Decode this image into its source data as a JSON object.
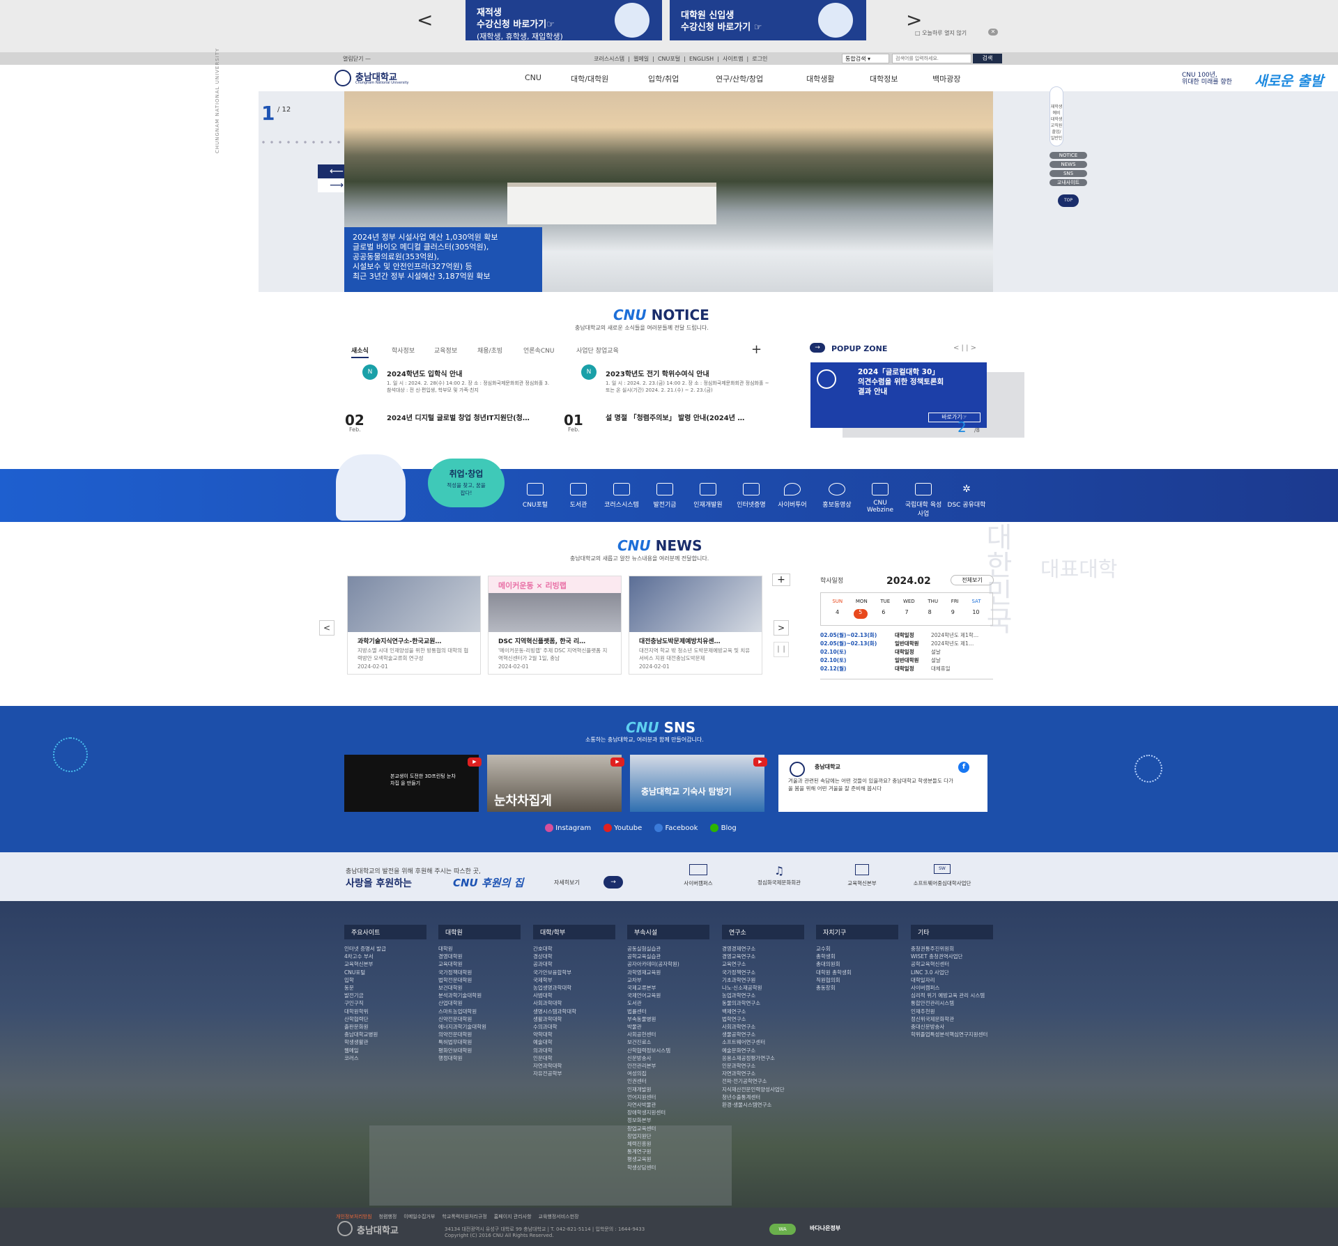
{
  "top_banner": {
    "btn1_line1": "재적생",
    "btn1_line2": "수강신청 바로가기☞",
    "btn1_line3": "(재학생, 휴학생, 재입학생)",
    "btn2_line1": "대학원 신입생",
    "btn2_line2": "수강신청 바로가기 ☞",
    "prev": "<",
    "next": ">",
    "close_today": "□ 오늘하루 열지 않기"
  },
  "util": {
    "quicklinks": "열림닫기 —",
    "menu": "코러스시스템  |  웹메일  |  CNU포털  |  ENGLISH  |  사이트맵  |  로그인",
    "search_scope": "통합검색",
    "search_placeholder": "검색어를 입력하세요.",
    "search_btn": "검색"
  },
  "gnb": {
    "logo_text": "충남대학교",
    "logo_sub": "Chungnam National University",
    "items": [
      "CNU",
      "대학/대학원",
      "입학/취업",
      "연구/산학/창업",
      "대학생활",
      "대학정보",
      "백마광장"
    ],
    "slogan_small": "CNU 100년,",
    "slogan_small2": "위대한 미래를 향한",
    "slogan_big": "새로운 출발"
  },
  "hero": {
    "counter_current": "1",
    "counter_total": "/ 12",
    "vertical_text": "CHUNGNAM NATIONAL UNIVERSITY",
    "caption": [
      "2024년 정부 시설사업 예산 1,030억원 확보",
      "글로벌 바이오 메디컬 클러스터(305억원),",
      "공공동물의료원(353억원),",
      "시설보수 및 안전인프라(327억원) 등",
      "최근 3년간 정부 시설예산 3,187억원 확보"
    ],
    "side_menu": [
      "재학생",
      "예비 대학생",
      "교직원",
      "졸업/일반인"
    ],
    "side_pills": [
      "NOTICE",
      "NEWS",
      "SNS",
      "교내사이트"
    ],
    "top": "TOP"
  },
  "notice": {
    "title_em": "CNU",
    "title": "NOTICE",
    "subtitle": "충남대학교의 새로운 소식들을 여러분들께 전달 드립니다.",
    "tabs": [
      "새소식",
      "학사정보",
      "교육정보",
      "채용/초빙",
      "언론속CNU",
      "사업단 창업교육"
    ],
    "items": [
      {
        "badge": "N",
        "title": "2024학년도 입학식 안내",
        "desc": "1. 일 시 : 2024. 2. 28(수) 14:00 2. 장 소 : 정심화국제문화회관 정심화홀 3. 참석대상 : 전 신·편입생, 학부모 및 가족·친지"
      },
      {
        "badge": "N",
        "title": "2023학년도 전기 학위수여식 안내",
        "desc": "1. 일 시 : 2024. 2. 23.(금) 14:00 2. 장 소 : 정심화국제문화회관 정심화홀 ~ 또는 온 실시(기간) 2024. 2. 21.(수) ~ 2. 23.(금)"
      },
      {
        "day": "02",
        "month": "Feb.",
        "title": "2024년 디지털 글로벌 창업 청년IT지원단(청…"
      },
      {
        "day": "01",
        "month": "Feb.",
        "title": "설 명절 「청렴주의보」 발령 안내(2024년 …"
      }
    ],
    "popup_title": "POPUP ZONE",
    "popup_ctrl": "< | | >",
    "popup_text": [
      "2024「글로컬대학 30」",
      "의견수렴을 위한 정책토론회",
      "결과 안내"
    ],
    "popup_btn": "바로가기☞",
    "popup_counter": "2",
    "popup_total": "/8"
  },
  "band": {
    "badge_title": "취업·창업",
    "badge_sub": "적성을 찾고, 꿈을 잡다!",
    "links": [
      "CNU포털",
      "도서관",
      "코러스시스템",
      "발전기금",
      "인재개발원",
      "인터넷증명",
      "사이버투어",
      "홍보동영상",
      "CNU Webzine",
      "국립대학 육성사업",
      "DSC 공유대학"
    ]
  },
  "news": {
    "title_em": "CNU",
    "title": "NEWS",
    "subtitle": "충남대학교의 새롭고 알찬 뉴스내용을 여러분께 전달합니다.",
    "cards": [
      {
        "title": "과학기술지식연구소-한국교원…",
        "desc": "지방소멸 시대 인재양성을 위한 방통협의 대학의 협력방안 모색학술교류회 연구성",
        "date": "2024-02-01"
      },
      {
        "title": "DSC 지역혁신플랫폼, 한국 리…",
        "desc": "'메이커운동-리빙랩' 주제 DSC 지역혁신플랫폼 지역혁신센터가 2월 1일, 충남",
        "date": "2024-02-01"
      },
      {
        "title": "대전충남도박문제예방치유센…",
        "desc": "대전지역 학교 밖 청소년 도박문제예방교육 및 치유서비스 지원 대전충남도박문제",
        "date": "2024-02-01"
      }
    ],
    "card2_banner": "메이커운동 × 리빙랩",
    "bg_text1": "대한민국",
    "bg_text2": "대표대학",
    "calendar_title": "학사일정",
    "calendar_month": "2024.02",
    "calendar_all": "전체보기",
    "weekdays": [
      "SUN",
      "MON",
      "TUE",
      "WED",
      "THU",
      "FRI",
      "SAT"
    ],
    "days": [
      "4",
      "5",
      "6",
      "7",
      "8",
      "9",
      "10"
    ],
    "events": [
      {
        "date": "02.05(월)~02.13(화)",
        "cat": "대학일정",
        "text": "2024학년도 제1학…"
      },
      {
        "date": "02.05(월)~02.13(화)",
        "cat": "일반대학원",
        "text": "2024학년도 제1…"
      },
      {
        "date": "02.10(토)",
        "cat": "대학일정",
        "text": "설날"
      },
      {
        "date": "02.10(토)",
        "cat": "일반대학원",
        "text": "설날"
      },
      {
        "date": "02.12(월)",
        "cat": "대학일정",
        "text": "대체휴일"
      }
    ]
  },
  "sns": {
    "title_em": "CNU",
    "title": "SNS",
    "subtitle": "소통하는 충남대학교, 여러분과 함께 만들어갑니다.",
    "card_texts": [
      "본교생이 도전한 3D프린팅 눈차차집 을 만들기",
      "눈차차집게",
      "충남대학교 기숙사 탐방기"
    ],
    "fb_name": "충남대학교",
    "fb_text": "겨울과 관련된 속담에는 어떤 것들이 있을까요? 충남대학교 학생분들도 다가올 봄을 위해 어떤 겨울을 잘 준비해 봅시다",
    "channels": [
      "Instagram",
      "Youtube",
      "Facebook",
      "Blog"
    ]
  },
  "donate": {
    "line1": "충남대학교의 발전을 위해 후원해 주시는 따스한 곳,",
    "line2a": "사랑을 후원하는",
    "line2b": "CNU 후원의 집",
    "more": "자세히보기",
    "items": [
      "사이버캠퍼스",
      "정심화국제문화회관",
      "교육혁신본부",
      "소프트웨어중심대학사업단"
    ]
  },
  "footer": {
    "columns": [
      {
        "title": "주요사이트",
        "items": [
          "인터넷 증명서 발급",
          "4차고수 부서",
          "교육혁신본부",
          "CNU포털",
          "입학",
          "동문",
          "발전기금",
          "구인구직",
          "대학원학위",
          "산학협력단",
          "출판문화원",
          "충남대학교병원",
          "학생생활관",
          "웹메일",
          "코러스"
        ]
      },
      {
        "title": "대학원",
        "items": [
          "대학원",
          "경영대학원",
          "교육대학원",
          "국가정책대학원",
          "법학전문대학원",
          "보건대학원",
          "분석과학기술대학원",
          "산업대학원",
          "스마트농업대학원",
          "신약전문대학원",
          "에너지과학기술대학원",
          "의약전문대학원",
          "특허법무대학원",
          "평화안보대학원",
          "행정대학원"
        ]
      },
      {
        "title": "대학/학부",
        "items": [
          "간호대학",
          "경상대학",
          "공과대학",
          "국가안보융합학부",
          "국제학부",
          "농업생명과학대학",
          "사범대학",
          "사회과학대학",
          "생명시스템과학대학",
          "생활과학대학",
          "수의과대학",
          "약학대학",
          "예술대학",
          "의과대학",
          "인문대학",
          "자연과학대학",
          "자유전공학부"
        ]
      },
      {
        "title": "부속시설",
        "items": [
          "공동실험실습관",
          "공학교육실습관",
          "공자아카데미(공자학원)",
          "과학영재교육원",
          "교차부",
          "국제교류본부",
          "국제언어교육원",
          "도서관",
          "법률센터",
          "부속동물병원",
          "박물관",
          "사회공헌센터",
          "보건진료소",
          "산학협력정보시스템",
          "신문방송사",
          "안전관리본부",
          "여성의집",
          "인권센터",
          "인재개발원",
          "언어지원센터",
          "자연사박물관",
          "장애학생지원센터",
          "정보화본부",
          "창업교육센터",
          "창업지원단",
          "체력진흥원",
          "통계연구원",
          "평생교육원",
          "학생상담센터"
        ]
      },
      {
        "title": "연구소",
        "items": [
          "경영경제연구소",
          "경영교육연구소",
          "교육연구소",
          "국가정책연구소",
          "기초과학연구원",
          "나노·신소재공학원",
          "농업과학연구소",
          "동물의과학연구소",
          "백제연구소",
          "법학연구소",
          "사회과학연구소",
          "생물공학연구소",
          "소프트웨어연구센터",
          "예술문화연구소",
          "응용소재공정평가연구소",
          "인문과학연구소",
          "자연과학연구소",
          "전파·전기공학연구소",
          "지식재산전문인력양성사업단",
          "청년수출통계센터",
          "환경·생물시스템연구소"
        ]
      },
      {
        "title": "자치기구",
        "items": [
          "교수회",
          "총학생회",
          "총대의원회",
          "대학원 총학생회",
          "직원협의회",
          "총동창회"
        ]
      },
      {
        "title": "기타",
        "items": [
          "충청권통주진위원회",
          "WISET 충청권역사업단",
          "공학교육혁신센터",
          "LINC 3.0 사업단",
          "대학일자리",
          "사이버캠퍼스",
          "심리적 위기 예방교육 관리 시스템",
          "통합안전관리시스템",
          "인재추천원",
          "정신위국제문화학관",
          "충대신문방송사",
          "학위졸업특성분석핵심연구지원센터"
        ]
      }
    ],
    "policy_links": [
      "개인정보처리방침",
      "청렴행정",
      "이메일수집거부",
      "학교폭력지원처리규정",
      "홈페이지 관리사항",
      "교육행정서비스헌장"
    ],
    "address": "34134 대전광역시 유성구 대학로 99 충남대학교 | T. 042-821-5114 | 입학문의 : 1644-9433",
    "copyright": "Copyright (C) 2016 CNU All Rights Reserved.",
    "logo_text": "충남대학교",
    "cert1": "WA",
    "cert2": "바다나은정부"
  },
  "colors": {
    "primary": "#1d53b3",
    "navy": "#1a2d6b",
    "accent": "#1d6fd8",
    "calendar_today": "#e8491d"
  }
}
